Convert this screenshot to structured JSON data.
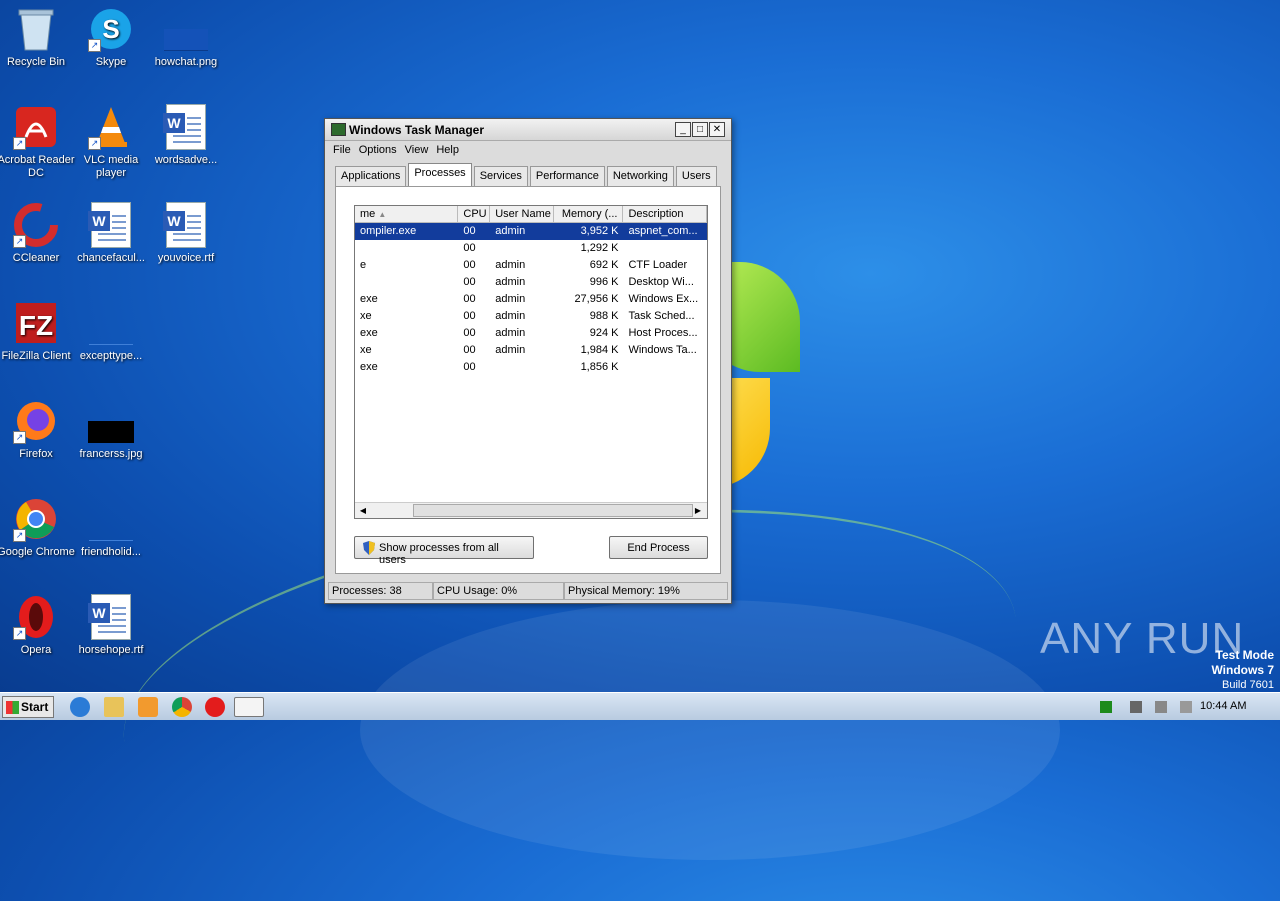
{
  "desktop": {
    "icons": [
      {
        "label": "Recycle Bin",
        "icon": "recycle-bin-icon"
      },
      {
        "label": "Skype",
        "icon": "skype-icon"
      },
      {
        "label": "howchat.png",
        "icon": "image-file-icon"
      },
      {
        "label": "Acrobat Reader DC",
        "icon": "acrobat-icon"
      },
      {
        "label": "VLC media player",
        "icon": "vlc-icon"
      },
      {
        "label": "wordsadve...",
        "icon": "word-doc-icon"
      },
      {
        "label": "CCleaner",
        "icon": "ccleaner-icon"
      },
      {
        "label": "chancefacul...",
        "icon": "word-doc-icon"
      },
      {
        "label": "youvoice.rtf",
        "icon": "word-doc-icon"
      },
      {
        "label": "FileZilla Client",
        "icon": "filezilla-icon"
      },
      {
        "label": "excepttype...",
        "icon": "file-icon"
      },
      {
        "label": "Firefox",
        "icon": "firefox-icon"
      },
      {
        "label": "francerss.jpg",
        "icon": "image-file-icon"
      },
      {
        "label": "Google Chrome",
        "icon": "chrome-icon"
      },
      {
        "label": "friendholid...",
        "icon": "file-icon"
      },
      {
        "label": "Opera",
        "icon": "opera-icon"
      },
      {
        "label": "horsehope.rtf",
        "icon": "word-doc-icon"
      }
    ],
    "watermark": "ANY RUN",
    "test_mode": {
      "line1": "Test Mode",
      "line2": "Windows 7",
      "line3": "Build 7601"
    }
  },
  "task_manager": {
    "title": "Windows Task Manager",
    "menu": [
      "File",
      "Options",
      "View",
      "Help"
    ],
    "tabs": [
      "Applications",
      "Processes",
      "Services",
      "Performance",
      "Networking",
      "Users"
    ],
    "active_tab": "Processes",
    "columns": [
      "me",
      "CPU",
      "User Name",
      "Memory (...",
      "Description"
    ],
    "rows": [
      {
        "name": "ompiler.exe",
        "cpu": "00",
        "user": "admin",
        "mem": "3,952 K",
        "desc": "aspnet_com...",
        "selected": true
      },
      {
        "name": "",
        "cpu": "00",
        "user": "",
        "mem": "1,292 K",
        "desc": ""
      },
      {
        "name": "e",
        "cpu": "00",
        "user": "admin",
        "mem": "692 K",
        "desc": "CTF Loader"
      },
      {
        "name": "",
        "cpu": "00",
        "user": "admin",
        "mem": "996 K",
        "desc": "Desktop Wi..."
      },
      {
        "name": "exe",
        "cpu": "00",
        "user": "admin",
        "mem": "27,956 K",
        "desc": "Windows Ex..."
      },
      {
        "name": "xe",
        "cpu": "00",
        "user": "admin",
        "mem": "988 K",
        "desc": "Task Sched..."
      },
      {
        "name": "exe",
        "cpu": "00",
        "user": "admin",
        "mem": "924 K",
        "desc": "Host Proces..."
      },
      {
        "name": "xe",
        "cpu": "00",
        "user": "admin",
        "mem": "1,984 K",
        "desc": "Windows Ta..."
      },
      {
        "name": "exe",
        "cpu": "00",
        "user": "",
        "mem": "1,856 K",
        "desc": ""
      }
    ],
    "show_all_label": "Show processes from all users",
    "end_process_label": "End Process",
    "status": {
      "processes": "Processes: 38",
      "cpu": "CPU Usage: 0%",
      "memory": "Physical Memory: 19%"
    }
  },
  "taskbar": {
    "start_label": "Start",
    "clock": "10:44 AM"
  }
}
